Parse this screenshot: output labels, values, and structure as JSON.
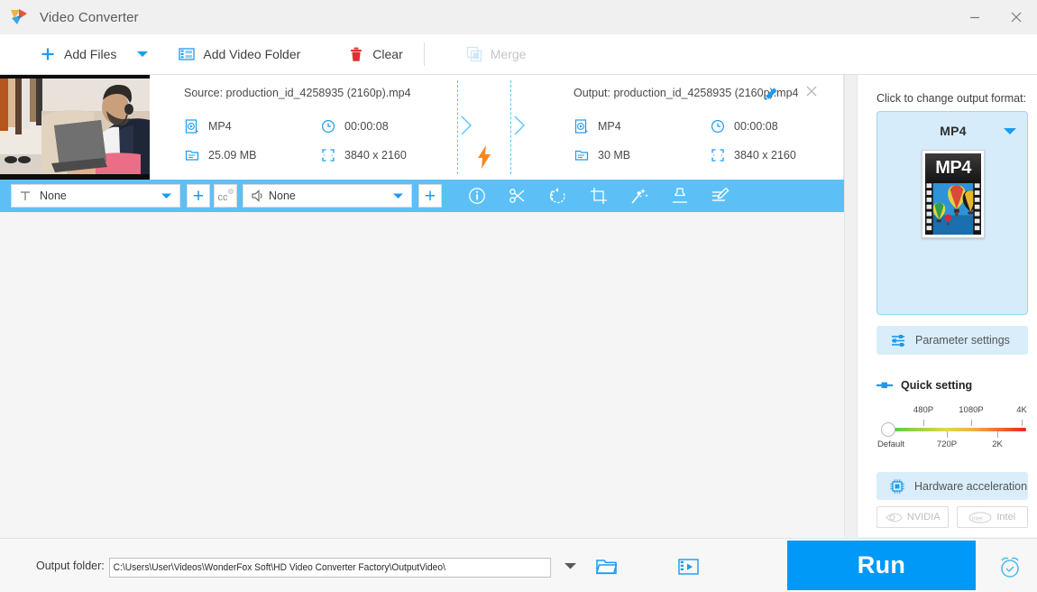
{
  "window": {
    "title": "Video Converter",
    "minimize_label": "Minimize",
    "close_label": "Close"
  },
  "toolbar": {
    "add_files": "Add Files",
    "add_files_caret": "dropdown",
    "add_video_folder": "Add Video Folder",
    "clear": "Clear",
    "merge": "Merge",
    "merge_disabled": true
  },
  "file_card": {
    "source_title": "Source: production_id_4258935 (2160p).mp4",
    "output_title": "Output: production_id_4258935 (2160p).mp4",
    "source": {
      "format": "MP4",
      "duration": "00:00:08",
      "size": "25.09 MB",
      "resolution": "3840 x 2160"
    },
    "output": {
      "format": "MP4",
      "duration": "00:00:08",
      "size": "30 MB",
      "resolution": "3840 x 2160"
    },
    "edit_label": "Edit output name",
    "remove_label": "Remove"
  },
  "action_bar": {
    "subtitle_value": "None",
    "subtitle_add": "+",
    "cc_label": "CC settings",
    "audio_value": "None",
    "audio_add": "+",
    "tools": [
      {
        "name": "info-icon",
        "label": "Info"
      },
      {
        "name": "cut-icon",
        "label": "Cut"
      },
      {
        "name": "rotate-icon",
        "label": "Rotate"
      },
      {
        "name": "crop-icon",
        "label": "Crop"
      },
      {
        "name": "effect-icon",
        "label": "Effects"
      },
      {
        "name": "watermark-icon",
        "label": "Watermark"
      },
      {
        "name": "subtitle-icon",
        "label": "Subtitle"
      }
    ]
  },
  "right_panel": {
    "change_format_label": "Click to change output format:",
    "format_name": "MP4",
    "thumb_caption": "MP4",
    "parameter_settings": "Parameter settings",
    "quick_setting": "Quick setting",
    "hardware_acceleration": "Hardware acceleration",
    "gpu": [
      {
        "name": "NVIDIA",
        "enabled": false
      },
      {
        "name": "Intel",
        "enabled": false
      }
    ]
  },
  "quality_slider": {
    "value": "Default",
    "ticks_above": [
      {
        "label": "480P",
        "pos": 25
      },
      {
        "label": "1080P",
        "pos": 60
      },
      {
        "label": "4K",
        "pos": 97
      }
    ],
    "ticks_below": [
      {
        "label": "Default",
        "pos": 4
      },
      {
        "label": "720P",
        "pos": 42
      },
      {
        "label": "2K",
        "pos": 79
      }
    ]
  },
  "bottom_bar": {
    "output_folder_label": "Output folder:",
    "output_folder_path": "C:\\Users\\User\\Videos\\WonderFox Soft\\HD Video Converter Factory\\OutputVideo\\",
    "open_folder_label": "Open folder",
    "media_label": "Open media",
    "run_label": "Run",
    "schedule_label": "Schedule"
  },
  "colors": {
    "accent": "#0099f7",
    "action_bar": "#5cc0f7",
    "panel_highlight": "#d6ecfa",
    "bolt": "#f7881f"
  }
}
